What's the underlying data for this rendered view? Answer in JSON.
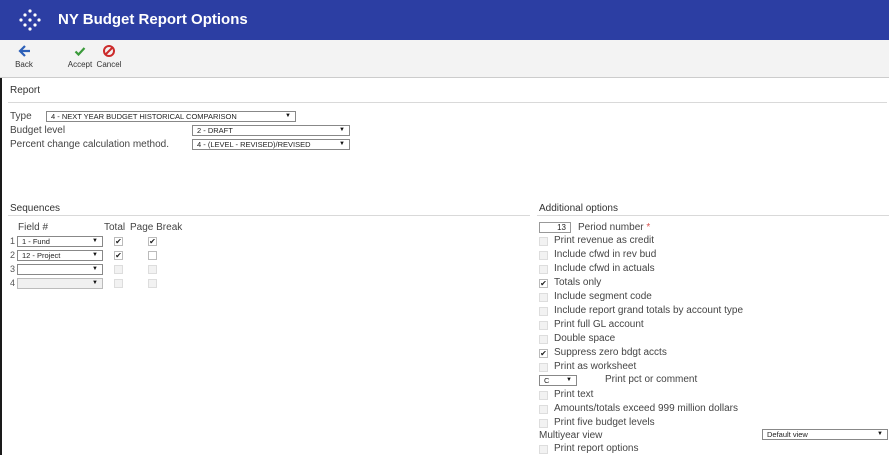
{
  "window": {
    "title": "NY Budget Report Options"
  },
  "toolbar": {
    "back_label": "Back",
    "accept_label": "Accept",
    "cancel_label": "Cancel"
  },
  "colors": {
    "titlebar": "#2c3ea3",
    "back_icon": "#2c5fb8",
    "accept_icon": "#3a9a3a",
    "cancel_icon": "#cc2b2b"
  },
  "report": {
    "section_label": "Report",
    "type_label": "Type",
    "type_value": "4 - NEXT YEAR BUDGET HISTORICAL COMPARISON",
    "budget_level_label": "Budget level",
    "budget_level_value": "2 - DRAFT",
    "pct_method_label": "Percent change calculation method.",
    "pct_method_value": "4 - (LEVEL - REVISED)/REVISED"
  },
  "sequences": {
    "section_label": "Sequences",
    "col_field": "Field #",
    "col_total": "Total",
    "col_page_break": "Page Break",
    "rows": [
      {
        "num": "1",
        "field": "1 - Fund",
        "total": true,
        "page_break": true,
        "enabled": true
      },
      {
        "num": "2",
        "field": "12 - Project",
        "total": true,
        "page_break": false,
        "enabled": true
      },
      {
        "num": "3",
        "field": "",
        "total": false,
        "page_break": false,
        "enabled": false
      },
      {
        "num": "4",
        "field": "",
        "total": false,
        "page_break": false,
        "enabled": false
      }
    ]
  },
  "additional": {
    "section_label": "Additional options",
    "period_number_value": "13",
    "period_number_label": "Period number",
    "required_mark": "*",
    "options": [
      {
        "label": "Print revenue as credit",
        "checked": false
      },
      {
        "label": "Include cfwd in rev bud",
        "checked": false
      },
      {
        "label": "Include cfwd in actuals",
        "checked": false
      },
      {
        "label": "Totals only",
        "checked": true
      },
      {
        "label": "Include segment code",
        "checked": false
      },
      {
        "label": "Include report grand totals by account type",
        "checked": false
      },
      {
        "label": "Print full GL account",
        "checked": false
      },
      {
        "label": "Double space",
        "checked": false
      },
      {
        "label": "Suppress zero bdgt accts",
        "checked": true
      },
      {
        "label": "Print as worksheet",
        "checked": false
      }
    ],
    "pct_comment_value": "C",
    "pct_comment_label": "Print pct or comment",
    "options2": [
      {
        "label": "Print text",
        "checked": false
      },
      {
        "label": "Amounts/totals exceed 999 million dollars",
        "checked": false
      },
      {
        "label": "Print five budget levels",
        "checked": false
      }
    ],
    "multiyear_label": "Multiyear view",
    "multiyear_value": "Default view",
    "print_report_options_label": "Print report options"
  }
}
